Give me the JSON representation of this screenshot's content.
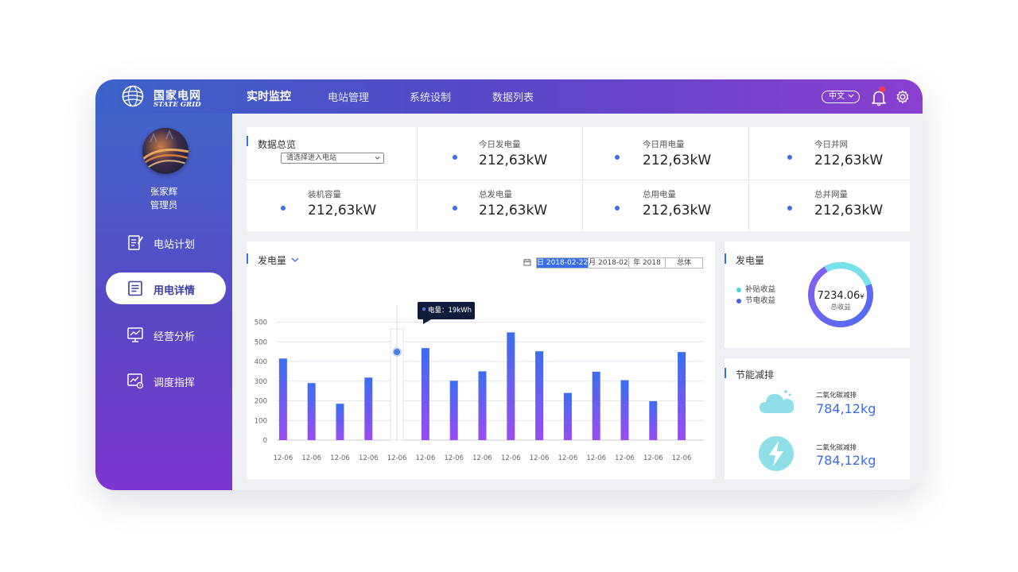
{
  "brand": {
    "name_cn": "国家电网",
    "name_en": "STATE GRID"
  },
  "topnav": {
    "tabs": [
      {
        "label": "实时监控",
        "active": true
      },
      {
        "label": "电站管理",
        "active": false
      },
      {
        "label": "系统设制",
        "active": false
      },
      {
        "label": "数据列表",
        "active": false
      }
    ],
    "language": "中文",
    "notification_count": 1
  },
  "user": {
    "name": "张家辉",
    "role": "管理员"
  },
  "sidebar": {
    "items": [
      {
        "label": "电站计划",
        "icon": "edit-document-icon",
        "active": false
      },
      {
        "label": "用电详情",
        "icon": "document-list-icon",
        "active": true
      },
      {
        "label": "经营分析",
        "icon": "trend-chart-icon",
        "active": false
      },
      {
        "label": "调度指挥",
        "icon": "dispatch-chart-icon",
        "active": false
      }
    ]
  },
  "overview": {
    "title": "数据总览",
    "select_placeholder": "请选择进入电站",
    "stats": [
      {
        "label": "今日发电量",
        "value": "212,63kW"
      },
      {
        "label": "今日用电量",
        "value": "212,63kW"
      },
      {
        "label": "今日并网",
        "value": "212,63kW"
      },
      {
        "label": "装机容量",
        "value": "212,63kW"
      },
      {
        "label": "总发电量",
        "value": "212,63kW"
      },
      {
        "label": "总用电量",
        "value": "212,63kW"
      },
      {
        "label": "总并网量",
        "value": "212,63kW"
      }
    ]
  },
  "generation_chart": {
    "title": "发电量",
    "date_tabs": [
      {
        "label": "日 2018-02-22",
        "active": true
      },
      {
        "label": "月 2018-02",
        "active": false
      },
      {
        "label": "年 2018",
        "active": false
      },
      {
        "label": "总体",
        "active": false
      }
    ],
    "tooltip": "电量：19kWh"
  },
  "chart_data": {
    "type": "bar",
    "categories": [
      "12-06",
      "12-06",
      "12-06",
      "12-06",
      "12-06",
      "12-06",
      "12-06",
      "12-06",
      "12-06",
      "12-06",
      "12-06",
      "12-06",
      "12-06",
      "12-06",
      "12-06"
    ],
    "values": [
      415,
      290,
      185,
      318,
      null,
      468,
      302,
      350,
      548,
      452,
      240,
      348,
      305,
      198,
      448
    ],
    "yticks": [
      0,
      100,
      200,
      300,
      400,
      500,
      500
    ],
    "ylim": [
      0,
      700
    ],
    "grid": true,
    "hover_index": 4,
    "colors": {
      "bar_top": "#3a6ef0",
      "bar_bottom": "#9a4cf2",
      "hover_dot": "#4a7be8"
    }
  },
  "revenue": {
    "title": "发电量",
    "legend": [
      {
        "label": "补贴收益",
        "color": "#4fd6d6"
      },
      {
        "label": "节电收益",
        "color": "#4a62e8"
      }
    ],
    "total_value": "7234.06",
    "total_unit": "¥",
    "total_label": "总收益",
    "ring": {
      "segments": [
        0.28,
        0.72
      ],
      "colors": [
        "#6fe0e8",
        "#6b5cf0"
      ]
    }
  },
  "energy_saving": {
    "title": "节能减排",
    "items": [
      {
        "label": "二氧化碳减排",
        "value": "784,12kg",
        "icon": "cloud-icon"
      },
      {
        "label": "二氧化碳减排",
        "value": "784,12kg",
        "icon": "lightning-icon"
      }
    ]
  },
  "colors": {
    "accent": "#3a6ee8",
    "topbar_start": "#3c63c9",
    "topbar_end": "#8a3fd0",
    "value_blue": "#3a6ee8"
  }
}
